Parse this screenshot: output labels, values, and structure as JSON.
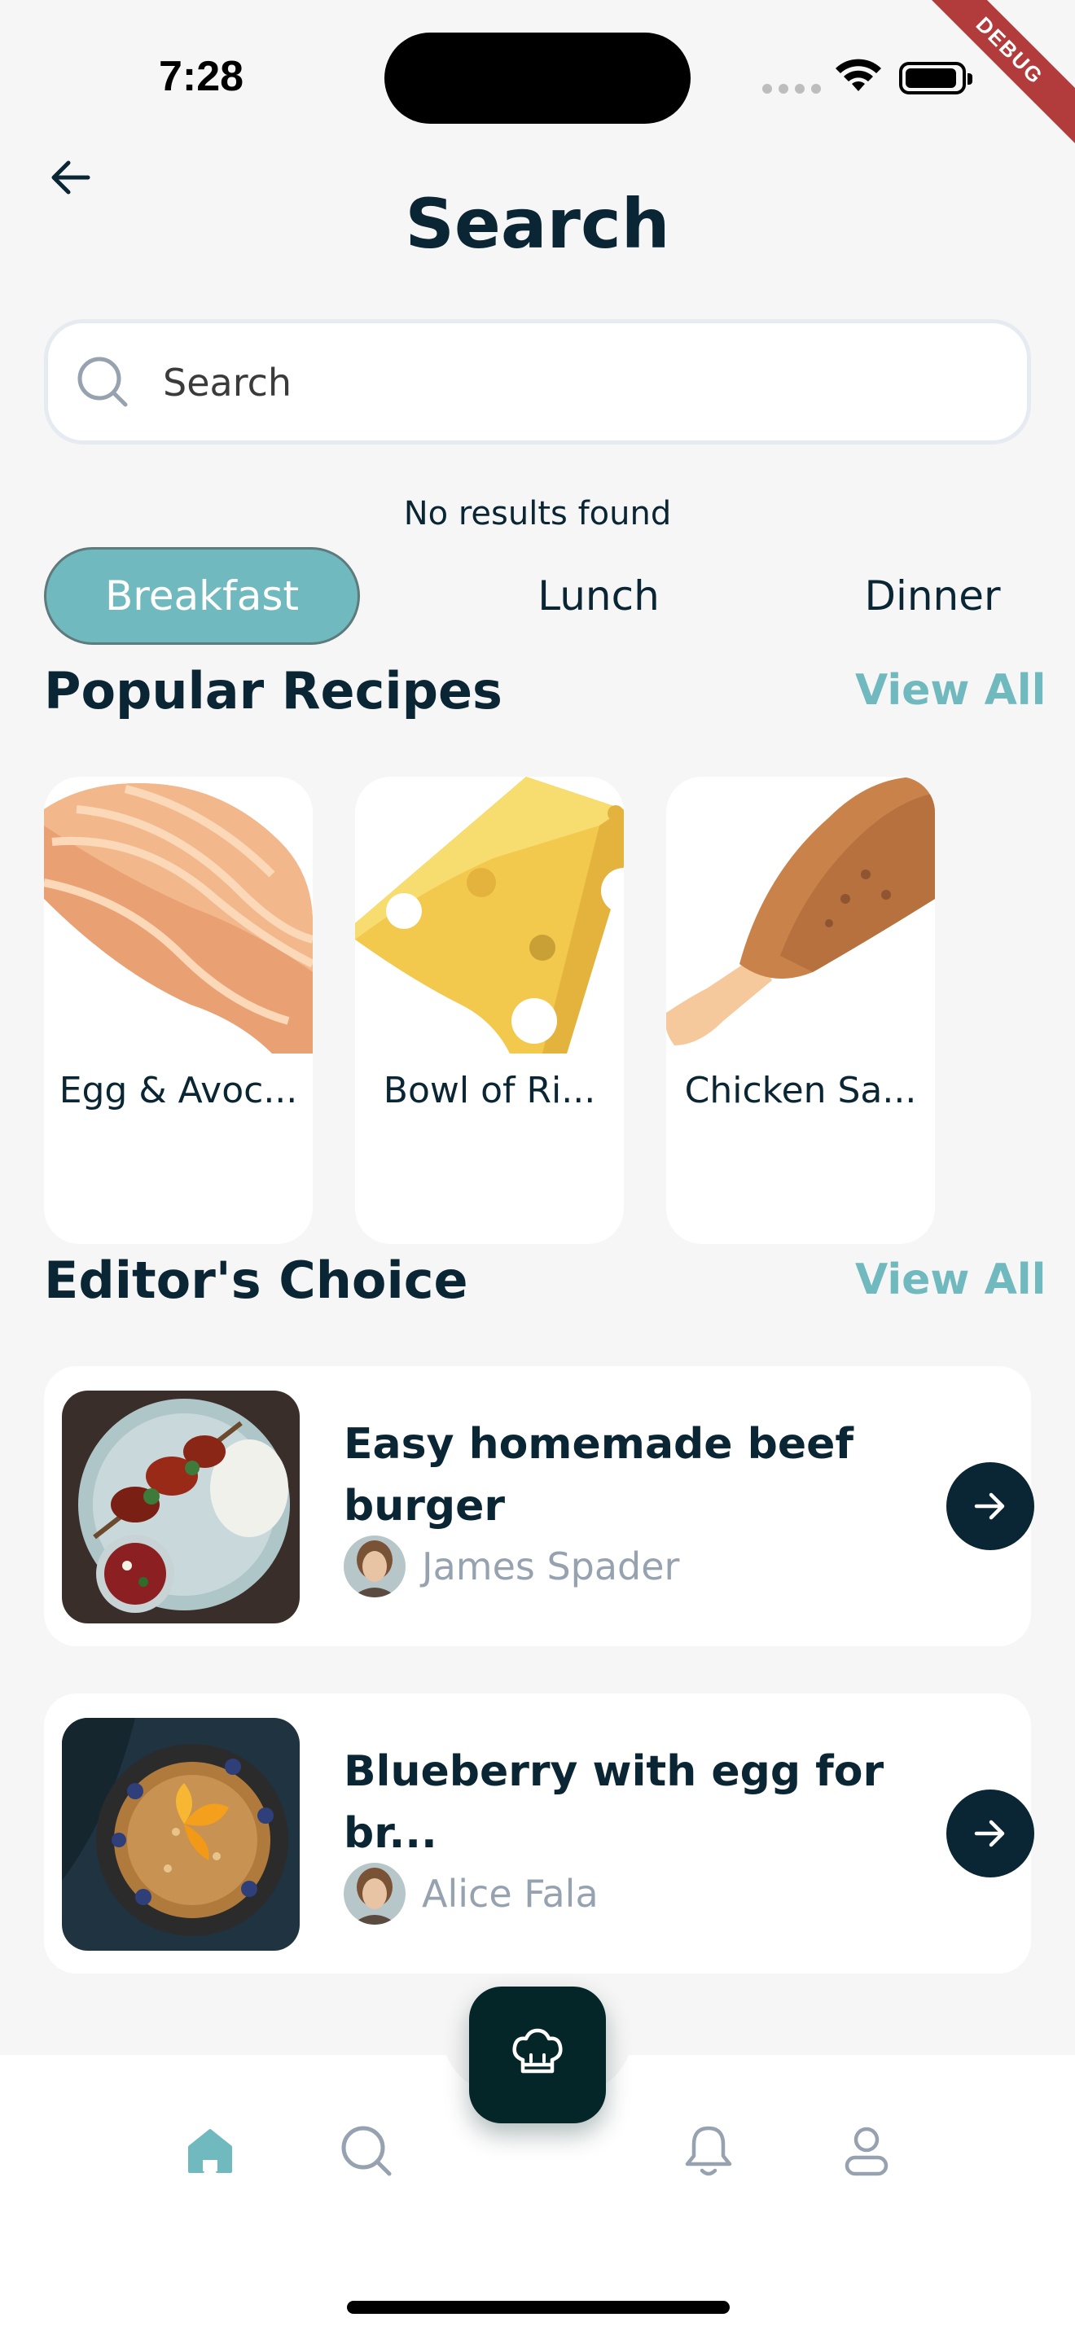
{
  "status_bar": {
    "time": "7:28",
    "debug_label": "DEBUG"
  },
  "header": {
    "title": "Search",
    "back_icon": "arrow-left-icon"
  },
  "search": {
    "placeholder": "Search",
    "value": ""
  },
  "results_message": "No results found",
  "categories": [
    {
      "label": "Breakfast",
      "active": true
    },
    {
      "label": "Lunch",
      "active": false
    },
    {
      "label": "Dinner",
      "active": false
    }
  ],
  "popular": {
    "title": "Popular Recipes",
    "view_all": "View All",
    "items": [
      {
        "label": "Egg & Avoc...",
        "icon": "salmon-illustration"
      },
      {
        "label": "Bowl of Ri...",
        "icon": "cheese-illustration"
      },
      {
        "label": "Chicken Sa...",
        "icon": "chicken-leg-illustration"
      }
    ]
  },
  "editors_choice": {
    "title": "Editor's Choice",
    "view_all": "View All",
    "items": [
      {
        "title": "Easy homemade beef burger",
        "author": "James Spader"
      },
      {
        "title": "Blueberry with egg for br...",
        "author": "Alice Fala"
      }
    ]
  },
  "bottom_nav": {
    "items": [
      "home-icon",
      "search-icon",
      "bell-icon",
      "profile-icon"
    ],
    "fab_icon": "chef-hat-icon",
    "active": "home-icon"
  },
  "colors": {
    "accent": "#70B9BE",
    "primary_dark": "#0A2533",
    "fab": "#042628",
    "background": "#F6F6F6",
    "muted_text": "#97A2B0"
  }
}
